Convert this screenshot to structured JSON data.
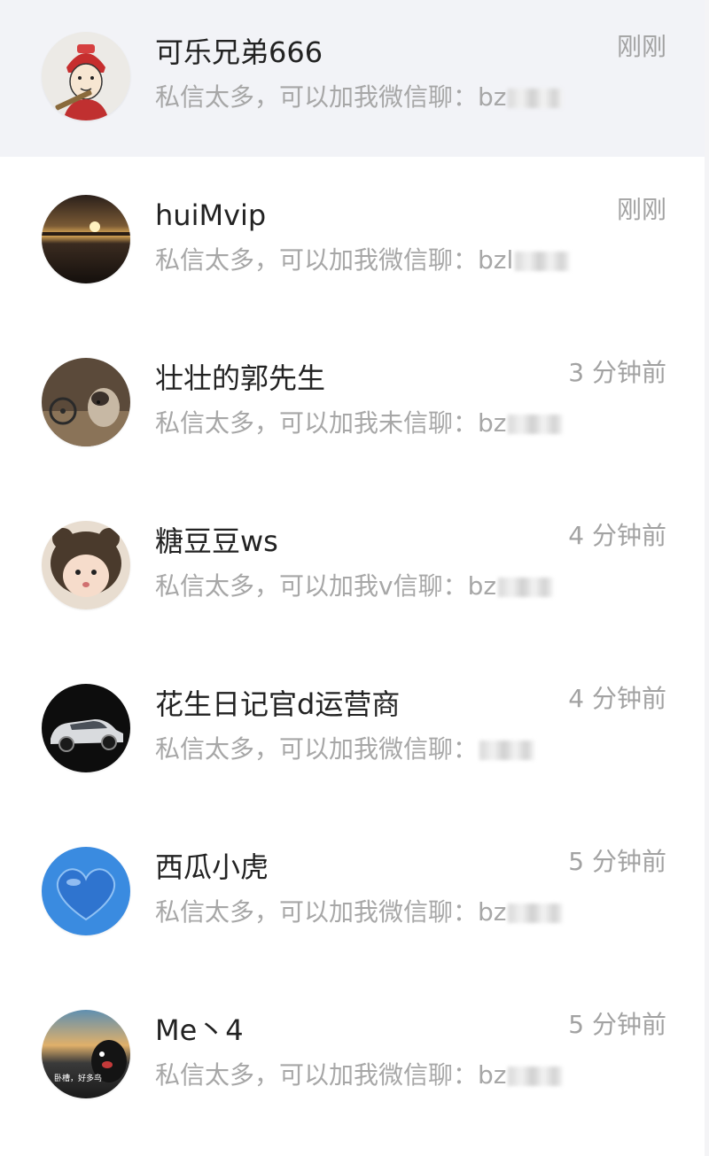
{
  "conversations": [
    {
      "name": "可乐兄弟666",
      "time": "刚刚",
      "preview": "私信太多，可以加我微信聊：bz",
      "avatar_icon": "cartoon-character-avatar"
    },
    {
      "name": "huiMvip",
      "time": "刚刚",
      "preview": "私信太多，可以加我微信聊：bzl",
      "avatar_icon": "sunset-avatar"
    },
    {
      "name": "壮壮的郭先生",
      "time": "3 分钟前",
      "preview": "私信太多，可以加我未信聊：bz",
      "avatar_icon": "dog-bicycle-avatar"
    },
    {
      "name": "糖豆豆ws",
      "time": "4 分钟前",
      "preview": "私信太多，可以加我v信聊：bz",
      "avatar_icon": "baby-bear-hat-avatar"
    },
    {
      "name": "花生日记官d运营商",
      "time": "4 分钟前",
      "preview": "私信太多，可以加我微信聊：",
      "avatar_icon": "car-avatar"
    },
    {
      "name": "西瓜小虎",
      "time": "5 分钟前",
      "preview": "私信太多，可以加我微信聊：bz",
      "avatar_icon": "blue-heart-avatar"
    },
    {
      "name": "Me丶4",
      "time": "5 分钟前",
      "preview": "私信太多，可以加我微信聊：bz",
      "avatar_icon": "bear-sunset-avatar",
      "avatar_caption": "卧槽，好多鸟"
    }
  ],
  "colors": {
    "highlight_row": "#f2f3f7",
    "name_text": "#222222",
    "muted_text": "#a7a7a7"
  }
}
